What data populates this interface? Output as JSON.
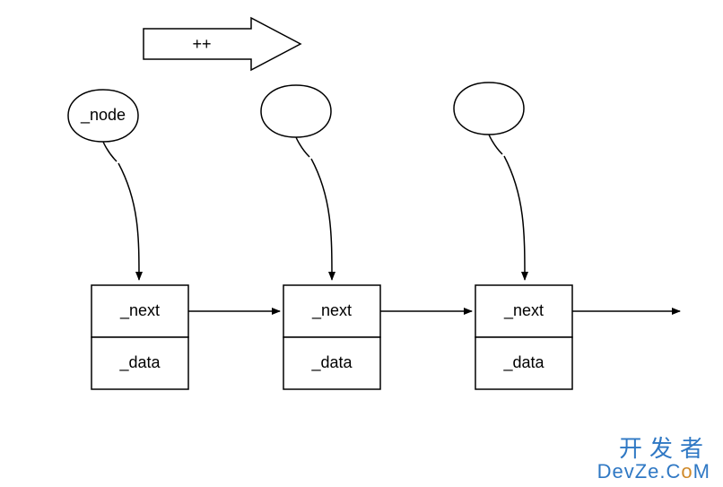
{
  "operator": "++",
  "bubbles": {
    "first": "_node",
    "second": "",
    "third": ""
  },
  "nodes": [
    {
      "top": "_next",
      "bottom": "_data"
    },
    {
      "top": "_next",
      "bottom": "_data"
    },
    {
      "top": "_next",
      "bottom": "_data"
    }
  ],
  "watermark": {
    "line1": "开发者",
    "line2_pre": "DevZe.C",
    "line2_o": "o",
    "line2_post": "M"
  }
}
